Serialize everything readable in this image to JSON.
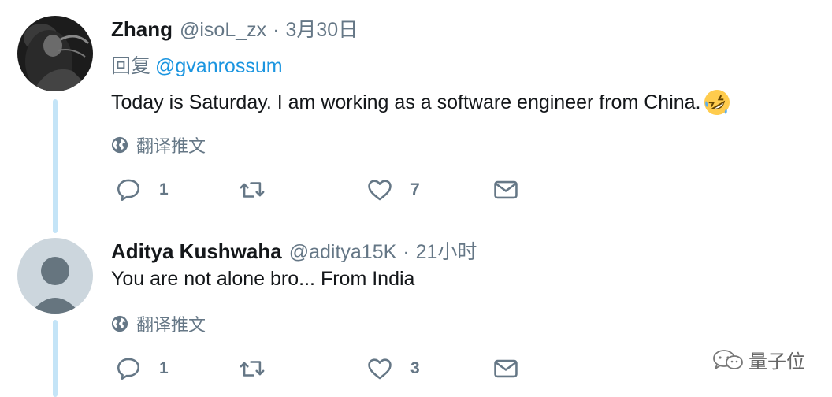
{
  "tweets": [
    {
      "name": "Zhang",
      "handle": "@isoL_zx",
      "separator": "·",
      "time": "3月30日",
      "reply_label": "回复",
      "reply_to": "@gvanrossum",
      "text": "Today is Saturday. I am working as a software engineer from China.",
      "emoji": "rolling-on-the-floor-laughing-emoji",
      "translate_label": "翻译推文",
      "replies": "1",
      "retweets": "",
      "likes": "7"
    },
    {
      "name": "Aditya Kushwaha",
      "handle": "@aditya15K",
      "separator": "·",
      "time": "21小时",
      "text": "You are not alone bro... From India",
      "translate_label": "翻译推文",
      "replies": "1",
      "retweets": "",
      "likes": "3"
    }
  ],
  "watermark": {
    "text": "量子位",
    "icon": "wechat-icon"
  },
  "colors": {
    "thread_line": "#c4e4f7",
    "link": "#1b95e0",
    "secondary": "#657786",
    "primary_text": "#14171a"
  }
}
